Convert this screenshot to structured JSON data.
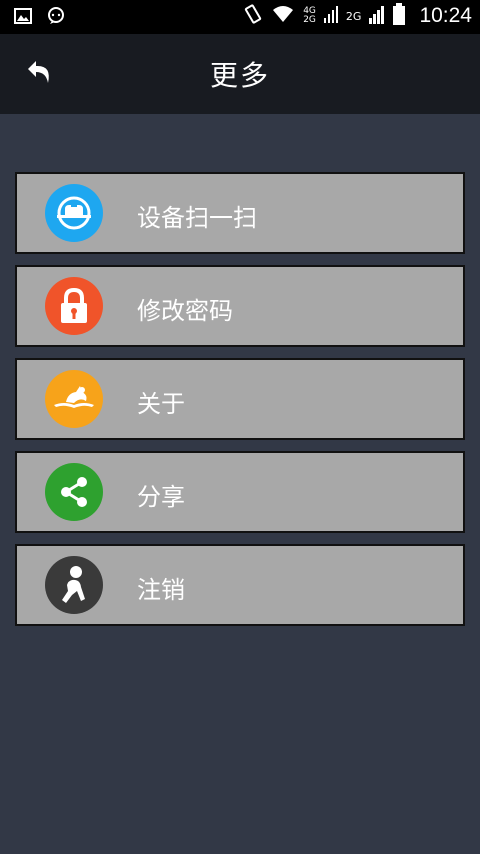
{
  "status_bar": {
    "network_4g": "4G",
    "network_2g_a": "2G",
    "network_2g_b": "2G",
    "time": "10:24"
  },
  "header": {
    "title": "更多",
    "back_icon": "back-arrow-icon"
  },
  "menu": {
    "items": [
      {
        "label": "设备扫一扫",
        "icon": "scan-icon",
        "color": "#1ea7f0"
      },
      {
        "label": "修改密码",
        "icon": "lock-icon",
        "color": "#f0542a"
      },
      {
        "label": "关于",
        "icon": "about-icon",
        "color": "#f7a31a"
      },
      {
        "label": "分享",
        "icon": "share-icon",
        "color": "#2ea12f"
      },
      {
        "label": "注销",
        "icon": "logout-icon",
        "color": "#3a3a3a"
      }
    ]
  },
  "colors": {
    "background": "#323846",
    "title_bar": "#181b21",
    "item_background": "#a8a8a8"
  }
}
